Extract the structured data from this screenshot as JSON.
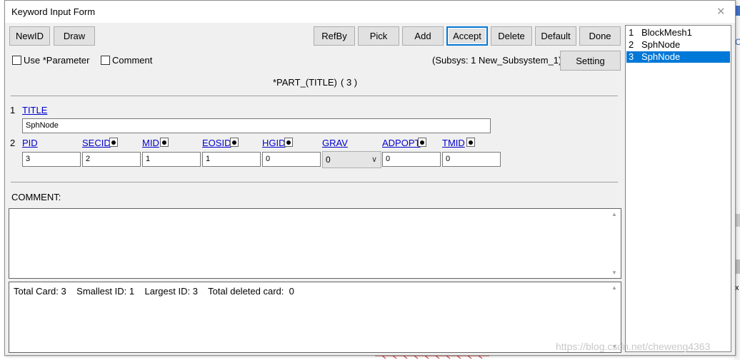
{
  "window": {
    "title": "Keyword Input Form"
  },
  "toolbar": {
    "left_buttons": [
      "NewID",
      "Draw"
    ],
    "right_buttons": [
      "RefBy",
      "Pick",
      "Add",
      "Accept",
      "Delete",
      "Default",
      "Done"
    ]
  },
  "options": {
    "use_parameter": "Use *Parameter",
    "comment": "Comment",
    "subsys": "(Subsys: 1 New_Subsystem_1)",
    "setting": "Setting"
  },
  "keyword": {
    "title": "*PART_(TITLE)",
    "count": "( 3 )"
  },
  "card1": {
    "row": "1",
    "field": "TITLE",
    "value": "SphNode"
  },
  "card2": {
    "row": "2",
    "fields": [
      {
        "label": "PID",
        "value": "3"
      },
      {
        "label": "SECID",
        "value": "2"
      },
      {
        "label": "MID",
        "value": "1"
      },
      {
        "label": "EOSID",
        "value": "1"
      },
      {
        "label": "HGID",
        "value": "0"
      },
      {
        "label": "GRAV",
        "value": "0"
      },
      {
        "label": "ADPOPT",
        "value": "0"
      },
      {
        "label": "TMID",
        "value": "0"
      }
    ]
  },
  "comment": {
    "label": "COMMENT:"
  },
  "status": {
    "text": "Total Card: 3    Smallest ID: 1    Largest ID: 3    Total deleted card:  0"
  },
  "list": {
    "items": [
      {
        "num": "1",
        "name": "BlockMesh1"
      },
      {
        "num": "2",
        "name": "SphNode"
      },
      {
        "num": "3",
        "name": "SphNode"
      }
    ],
    "selected_index": 2
  },
  "background": {
    "watermark": "https://blog.csdn.net/cheweng4363",
    "partial_letter": "x"
  },
  "colors": {
    "selection": "#0078d7",
    "link": "#0000cc",
    "window_bg": "#f0f0f0"
  }
}
